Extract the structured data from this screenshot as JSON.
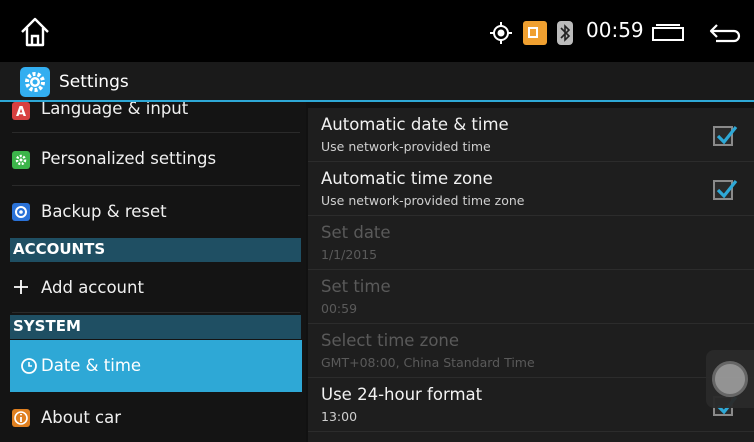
{
  "status": {
    "time": "00:59"
  },
  "app": {
    "title": "Settings"
  },
  "sidebar": {
    "items": [
      {
        "label": "Language & input",
        "icon": "language-icon",
        "color": "#d84040"
      },
      {
        "label": "Personalized settings",
        "icon": "personalize-icon",
        "color": "#3cb44a"
      },
      {
        "label": "Backup & reset",
        "icon": "backup-icon",
        "color": "#2a72d8"
      }
    ],
    "accounts_header": "ACCOUNTS",
    "add_account": "Add account",
    "system_header": "SYSTEM",
    "date_time": "Date & time",
    "about_car": "About car"
  },
  "detail": {
    "rows": [
      {
        "title": "Automatic date & time",
        "sub": "Use network-provided time",
        "checked": true,
        "enabled": true
      },
      {
        "title": "Automatic time zone",
        "sub": "Use network-provided time zone",
        "checked": true,
        "enabled": true
      },
      {
        "title": "Set date",
        "sub": "1/1/2015",
        "enabled": false
      },
      {
        "title": "Set time",
        "sub": "00:59",
        "enabled": false
      },
      {
        "title": "Select time zone",
        "sub": "GMT+08:00, China Standard Time",
        "enabled": false
      },
      {
        "title": "Use 24-hour format",
        "sub": "13:00",
        "checked": true,
        "enabled": true
      }
    ]
  },
  "colors": {
    "accent": "#2ea8d6",
    "section_bg": "#1f4f63",
    "check": "#2ea8d6"
  }
}
